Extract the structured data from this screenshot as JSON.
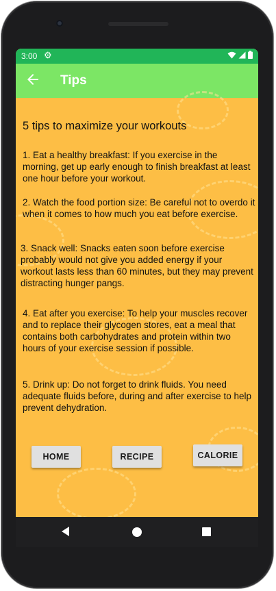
{
  "status_bar": {
    "time": "3:00",
    "settings_icon": "gear-icon",
    "wifi_icon": "wifi-icon",
    "signal_icon": "signal-icon",
    "battery_icon": "battery-icon"
  },
  "app_bar": {
    "title": "Tips",
    "back_icon": "arrow-back-icon"
  },
  "content": {
    "heading": "5 tips to maximize your workouts",
    "tips": [
      "1. Eat a healthy breakfast: If you exercise in the morning, get up early enough to finish breakfast at least one hour before your workout.",
      "2. Watch the food portion size: Be careful not to overdo it when it comes to how much you eat before exercise.",
      "3. Snack well: Snacks eaten soon before exercise probably would not give you added energy if your workout lasts less than 60 minutes, but they may prevent distracting hunger pangs.",
      "4. Eat after you exercise: To help your muscles recover and to replace their glycogen stores, eat a meal that contains both carbohydrates and protein within two hours of your exercise session if possible.",
      "5. Drink up: Do not forget to drink fluids. You need adequate fluids before, during and after exercise to help prevent dehydration."
    ]
  },
  "buttons": {
    "home": "HOME",
    "recipe": "RECIPE",
    "calorie": "CALORIE"
  },
  "nav_bar": {
    "back_icon": "nav-back-icon",
    "home_icon": "nav-home-icon",
    "recents_icon": "nav-recents-icon"
  },
  "colors": {
    "status_bar": "#21b558",
    "app_bar": "#7ce665",
    "background": "#fdbe45",
    "button": "#e0e0e0"
  }
}
